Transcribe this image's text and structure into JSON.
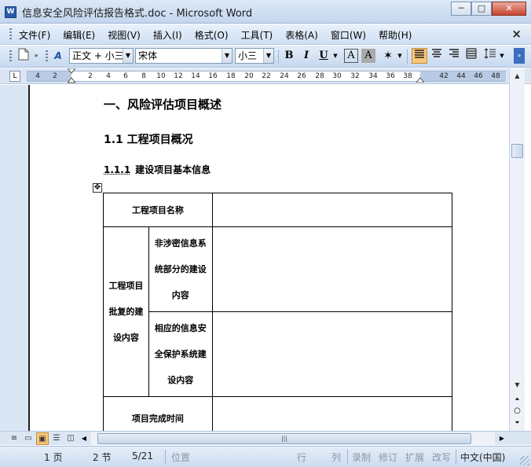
{
  "window": {
    "title": "信息安全风险评估报告格式.doc - Microsoft Word",
    "icon": "word-doc-icon",
    "icon_letter": "W",
    "minimize": "─",
    "maximize": "□",
    "close": "✕"
  },
  "menu": {
    "items": [
      "文件(F)",
      "编辑(E)",
      "视图(V)",
      "插入(I)",
      "格式(O)",
      "工具(T)",
      "表格(A)",
      "窗口(W)",
      "帮助(H)"
    ],
    "close_doc": "×"
  },
  "toolbar": {
    "style_value": "正文 + 小三",
    "font_value": "宋体",
    "size_value": "小三",
    "bold": "B",
    "italic": "I",
    "underline": "U",
    "char_border": "A",
    "char_shading": "A"
  },
  "ruler": {
    "corner": "L",
    "ticks": [
      "4",
      "2",
      "2",
      "4",
      "6",
      "8",
      "10",
      "12",
      "14",
      "16",
      "18",
      "20",
      "22",
      "24",
      "26",
      "28",
      "30",
      "32",
      "34",
      "36",
      "38",
      "42",
      "44",
      "46",
      "48"
    ]
  },
  "document": {
    "heading1": "一、风险评估项目概述",
    "heading2": "1.1  工程项目概况",
    "heading3_num": "1.1.1",
    "heading3_text": "建设项目基本信息",
    "table": {
      "row1_label": "工程项目名称",
      "group_label_lines": [
        "工程项目",
        "批复的建",
        "设内容"
      ],
      "sub1_lines": [
        "非涉密信息系",
        "统部分的建设",
        "内容"
      ],
      "sub2_lines": [
        "相应的信息安",
        "全保护系统建",
        "设内容"
      ],
      "row4_label": "项目完成时间"
    }
  },
  "statusbar": {
    "page": "1 页",
    "section": "2 节",
    "page_of": "5/21",
    "position": "位置",
    "line": "行",
    "column": "列",
    "rec": "录制",
    "trk": "修订",
    "ext": "扩展",
    "ovr": "改写",
    "language": "中文(中国)"
  },
  "colors": {
    "titlebar": "#c4d6ee",
    "toolbar_active": "#f8c67c",
    "page_bg": "#ffffff"
  }
}
